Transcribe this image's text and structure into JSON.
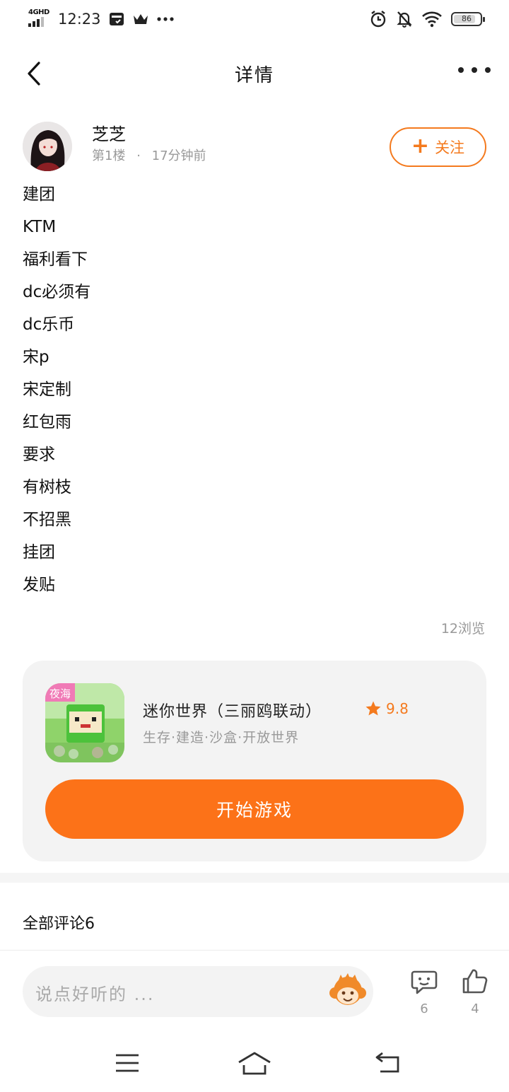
{
  "status_bar": {
    "network": "4GHD",
    "time": "12:23",
    "battery_level": "86",
    "battery_fraction": 0.86
  },
  "header": {
    "title": "详情"
  },
  "author": {
    "name": "芝芝",
    "floor": "第1楼",
    "separator": "·",
    "time_ago": "17分钟前",
    "follow_label": "关注"
  },
  "post": {
    "lines": [
      "建团",
      "KTM",
      "福利看下",
      "dc必须有",
      "dc乐币",
      "宋p",
      "宋定制",
      "红包雨",
      "要求",
      "有树枝",
      "不招黑",
      "挂团",
      "发贴"
    ],
    "views": "12浏览"
  },
  "game": {
    "icon_badge": "夜海",
    "name": "迷你世界（三丽鸥联动）",
    "rating": "9.8",
    "tags": "生存·建造·沙盒·开放世界",
    "play_label": "开始游戏"
  },
  "comments": {
    "title": "全部评论6",
    "input_placeholder": "说点好听的 ...",
    "comment_count": "6",
    "like_count": "4"
  },
  "colors": {
    "accent": "#fc7218",
    "follow_border": "#f47a1e",
    "card_bg": "#f3f3f3",
    "muted_text": "#999999"
  },
  "icons": {
    "back": "chevron-left-icon",
    "more": "more-dots-icon",
    "follow": "plus-icon",
    "rating": "star-icon",
    "emoji": "monkey-emoji-icon",
    "comment": "comment-bubble-icon",
    "like": "thumbs-up-icon",
    "sys_menu": "menu-lines-icon",
    "sys_home": "home-icon",
    "sys_back": "return-arrow-icon"
  }
}
